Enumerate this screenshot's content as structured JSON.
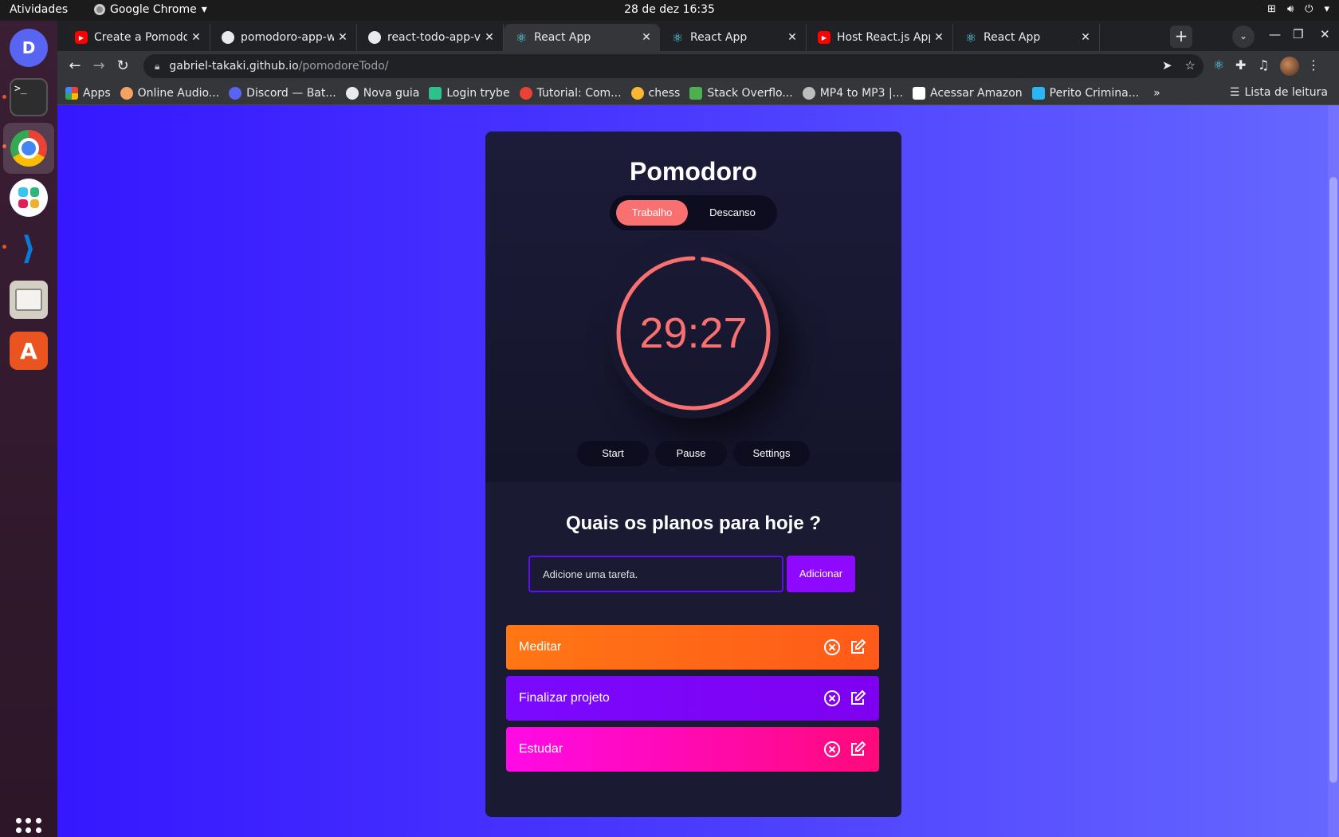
{
  "os": {
    "activities": "Atividades",
    "app_name": "Google Chrome",
    "clock": "28 de dez  16:35",
    "dock": [
      "discord",
      "terminal",
      "chrome",
      "slack",
      "vscode",
      "files",
      "software-center"
    ]
  },
  "browser": {
    "tabs": [
      {
        "title": "Create a Pomodoro",
        "icon": "youtube-icon"
      },
      {
        "title": "pomodoro-app-with",
        "icon": "github-icon"
      },
      {
        "title": "react-todo-app-v1/A",
        "icon": "github-icon"
      },
      {
        "title": "React App",
        "icon": "react-icon"
      },
      {
        "title": "React App",
        "icon": "react-icon"
      },
      {
        "title": "Host React.js App fo",
        "icon": "youtube-icon"
      },
      {
        "title": "React App",
        "icon": "react-icon"
      }
    ],
    "url_host": "gabriel-takaki.github.io",
    "url_path": "/pomodoreTodo/",
    "bookmarks": [
      "Apps",
      "Online Audio...",
      "Discord — Bat...",
      "Nova guia",
      "Login trybe",
      "Tutorial: Com...",
      "chess",
      "Stack Overflo...",
      "MP4 to MP3 |...",
      "Acessar Amazon",
      "Perito Crimina..."
    ],
    "reading_list": "Lista de leitura"
  },
  "app": {
    "title": "Pomodoro",
    "modes": {
      "work": "Trabalho",
      "break": "Descanso"
    },
    "timer": "29:27",
    "progress": 0.98,
    "accent": "#f87070",
    "controls": {
      "start": "Start",
      "pause": "Pause",
      "settings": "Settings"
    },
    "todo": {
      "heading": "Quais os planos para hoje ?",
      "placeholder": "Adicione uma tarefa.",
      "add_label": "Adicionar",
      "items": [
        {
          "label": "Meditar"
        },
        {
          "label": "Finalizar projeto"
        },
        {
          "label": "Estudar"
        }
      ]
    }
  }
}
